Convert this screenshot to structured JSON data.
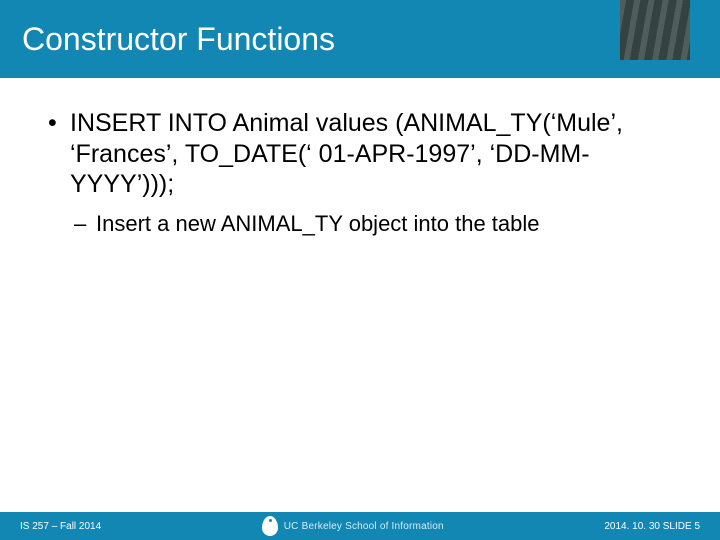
{
  "header": {
    "title": "Constructor Functions"
  },
  "content": {
    "bullet1": "INSERT INTO Animal values (ANIMAL_TY(‘Mule’, ‘Frances’, TO_DATE(‘ 01-APR-1997’, ‘DD-MM-YYYY’)));",
    "bullet2": "Insert a new ANIMAL_TY object into the table"
  },
  "footer": {
    "left": "IS 257 – Fall 2014",
    "org": "UC Berkeley School of Information",
    "right": "2014. 10. 30 SLIDE 5"
  }
}
